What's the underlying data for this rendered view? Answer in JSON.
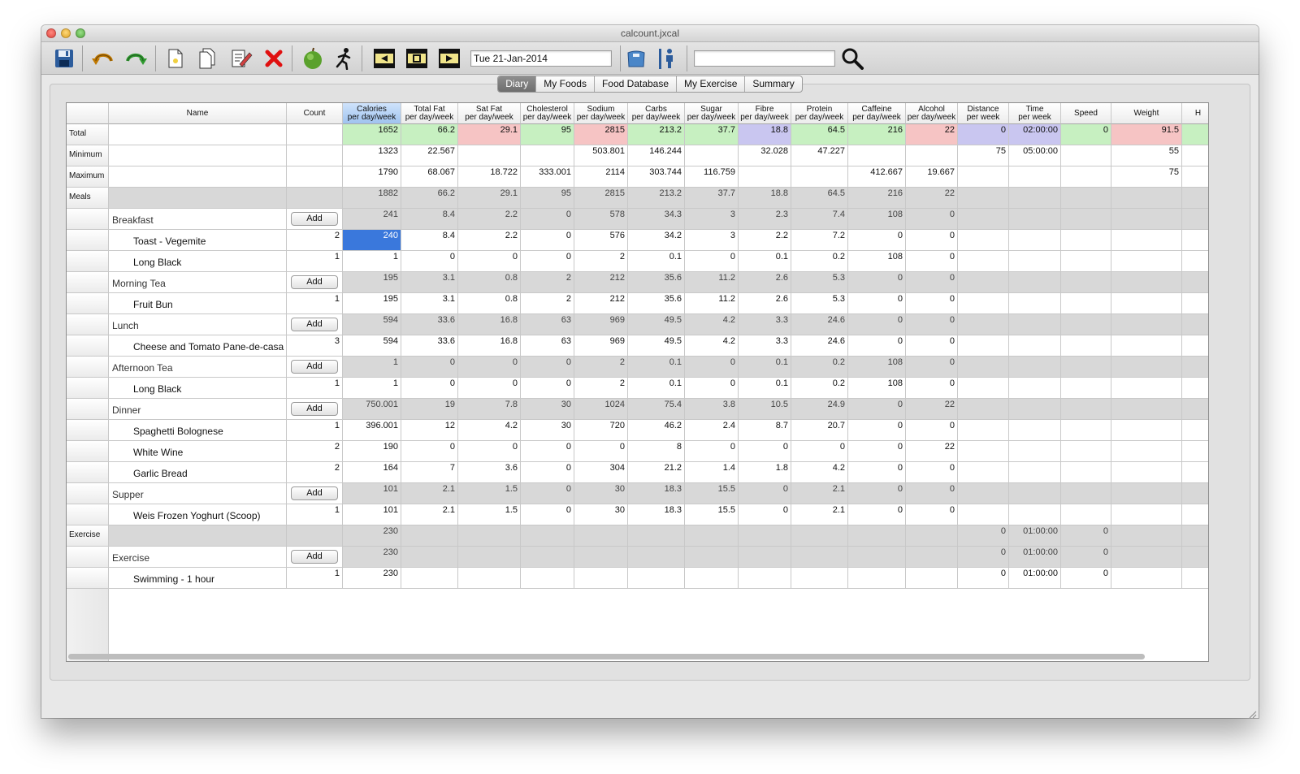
{
  "window": {
    "title": "calcount.jxcal"
  },
  "toolbar": {
    "icons": [
      "save-icon",
      "undo-icon",
      "redo-icon",
      "new-document-icon",
      "copy-document-icon",
      "edit-icon",
      "delete-icon",
      "apple-food-icon",
      "running-exercise-icon",
      "previous-day-icon",
      "today-icon",
      "next-day-icon",
      "scale-icon",
      "body-measure-icon",
      "search-icon"
    ],
    "date": "Tue 21-Jan-2014",
    "search_value": "",
    "colors": {
      "delete": "#e01010",
      "apple": "#5aa12c",
      "undo": "#c07800",
      "redo": "#2f9a2f"
    }
  },
  "tabs": [
    "Diary",
    "My Foods",
    "Food Database",
    "My Exercise",
    "Summary"
  ],
  "active_tab": "Diary",
  "columns": [
    {
      "h1": "Name",
      "h2": ""
    },
    {
      "h1": "Count",
      "h2": ""
    },
    {
      "h1": "Calories",
      "h2": "per day/week"
    },
    {
      "h1": "Total Fat",
      "h2": "per day/week"
    },
    {
      "h1": "Sat Fat",
      "h2": "per day/week"
    },
    {
      "h1": "Cholesterol",
      "h2": "per day/week"
    },
    {
      "h1": "Sodium",
      "h2": "per day/week"
    },
    {
      "h1": "Carbs",
      "h2": "per day/week"
    },
    {
      "h1": "Sugar",
      "h2": "per day/week"
    },
    {
      "h1": "Fibre",
      "h2": "per day/week"
    },
    {
      "h1": "Protein",
      "h2": "per day/week"
    },
    {
      "h1": "Caffeine",
      "h2": "per day/week"
    },
    {
      "h1": "Alcohol",
      "h2": "per day/week"
    },
    {
      "h1": "Distance",
      "h2": "per week"
    },
    {
      "h1": "Time",
      "h2": "per week"
    },
    {
      "h1": "Speed",
      "h2": ""
    },
    {
      "h1": "Weight",
      "h2": ""
    },
    {
      "h1": "H",
      "h2": ""
    }
  ],
  "add_label": "Add",
  "rows": [
    {
      "side": "Total",
      "type": "summary",
      "name": "",
      "count": "",
      "values": [
        "1652",
        "66.2",
        "29.1",
        "95",
        "2815",
        "213.2",
        "37.7",
        "18.8",
        "64.5",
        "216",
        "22",
        "0",
        "02:00:00",
        "0",
        "91.5",
        ""
      ],
      "colors": [
        "green",
        "green",
        "red",
        "green",
        "red",
        "green",
        "green",
        "blue",
        "green",
        "green",
        "red",
        "blue",
        "blue",
        "green",
        "red",
        "green"
      ]
    },
    {
      "side": "Minimum",
      "type": "summary",
      "name": "",
      "count": "",
      "values": [
        "1323",
        "22.567",
        "",
        "",
        "503.801",
        "146.244",
        "",
        "32.028",
        "47.227",
        "",
        "",
        "75",
        "05:00:00",
        "",
        "55",
        ""
      ]
    },
    {
      "side": "Maximum",
      "type": "summary",
      "name": "",
      "count": "",
      "values": [
        "1790",
        "68.067",
        "18.722",
        "333.001",
        "2114",
        "303.744",
        "116.759",
        "",
        "",
        "412.667",
        "19.667",
        "",
        "",
        "",
        "75",
        ""
      ]
    },
    {
      "side": "Meals",
      "type": "section",
      "name": "",
      "count": "",
      "values": [
        "1882",
        "66.2",
        "29.1",
        "95",
        "2815",
        "213.2",
        "37.7",
        "18.8",
        "64.5",
        "216",
        "22",
        "",
        "",
        "",
        "",
        ""
      ]
    },
    {
      "side": "",
      "type": "meal",
      "name": "Breakfast",
      "count": "",
      "values": [
        "241",
        "8.4",
        "2.2",
        "0",
        "578",
        "34.3",
        "3",
        "2.3",
        "7.4",
        "108",
        "0",
        "",
        "",
        "",
        "",
        ""
      ]
    },
    {
      "side": "",
      "type": "item",
      "selected": true,
      "name": "Toast - Vegemite",
      "count": "2",
      "values": [
        "240",
        "8.4",
        "2.2",
        "0",
        "576",
        "34.2",
        "3",
        "2.2",
        "7.2",
        "0",
        "0",
        "",
        "",
        "",
        "",
        ""
      ]
    },
    {
      "side": "",
      "type": "item",
      "name": "Long Black",
      "count": "1",
      "values": [
        "1",
        "0",
        "0",
        "0",
        "2",
        "0.1",
        "0",
        "0.1",
        "0.2",
        "108",
        "0",
        "",
        "",
        "",
        "",
        ""
      ]
    },
    {
      "side": "",
      "type": "meal",
      "name": "Morning Tea",
      "count": "",
      "values": [
        "195",
        "3.1",
        "0.8",
        "2",
        "212",
        "35.6",
        "11.2",
        "2.6",
        "5.3",
        "0",
        "0",
        "",
        "",
        "",
        "",
        ""
      ]
    },
    {
      "side": "",
      "type": "item",
      "name": "Fruit Bun",
      "count": "1",
      "values": [
        "195",
        "3.1",
        "0.8",
        "2",
        "212",
        "35.6",
        "11.2",
        "2.6",
        "5.3",
        "0",
        "0",
        "",
        "",
        "",
        "",
        ""
      ]
    },
    {
      "side": "",
      "type": "meal",
      "name": "Lunch",
      "count": "",
      "values": [
        "594",
        "33.6",
        "16.8",
        "63",
        "969",
        "49.5",
        "4.2",
        "3.3",
        "24.6",
        "0",
        "0",
        "",
        "",
        "",
        "",
        ""
      ]
    },
    {
      "side": "",
      "type": "item",
      "name": "Cheese and Tomato Pane-de-casa",
      "count": "3",
      "values": [
        "594",
        "33.6",
        "16.8",
        "63",
        "969",
        "49.5",
        "4.2",
        "3.3",
        "24.6",
        "0",
        "0",
        "",
        "",
        "",
        "",
        ""
      ]
    },
    {
      "side": "",
      "type": "meal",
      "name": "Afternoon Tea",
      "count": "",
      "values": [
        "1",
        "0",
        "0",
        "0",
        "2",
        "0.1",
        "0",
        "0.1",
        "0.2",
        "108",
        "0",
        "",
        "",
        "",
        "",
        ""
      ]
    },
    {
      "side": "",
      "type": "item",
      "name": "Long Black",
      "count": "1",
      "values": [
        "1",
        "0",
        "0",
        "0",
        "2",
        "0.1",
        "0",
        "0.1",
        "0.2",
        "108",
        "0",
        "",
        "",
        "",
        "",
        ""
      ]
    },
    {
      "side": "",
      "type": "meal",
      "name": "Dinner",
      "count": "",
      "values": [
        "750.001",
        "19",
        "7.8",
        "30",
        "1024",
        "75.4",
        "3.8",
        "10.5",
        "24.9",
        "0",
        "22",
        "",
        "",
        "",
        "",
        ""
      ]
    },
    {
      "side": "",
      "type": "item",
      "name": "Spaghetti Bolognese",
      "count": "1",
      "values": [
        "396.001",
        "12",
        "4.2",
        "30",
        "720",
        "46.2",
        "2.4",
        "8.7",
        "20.7",
        "0",
        "0",
        "",
        "",
        "",
        "",
        ""
      ]
    },
    {
      "side": "",
      "type": "item",
      "name": "White Wine",
      "count": "2",
      "values": [
        "190",
        "0",
        "0",
        "0",
        "0",
        "8",
        "0",
        "0",
        "0",
        "0",
        "22",
        "",
        "",
        "",
        "",
        ""
      ]
    },
    {
      "side": "",
      "type": "item",
      "name": "Garlic Bread",
      "count": "2",
      "values": [
        "164",
        "7",
        "3.6",
        "0",
        "304",
        "21.2",
        "1.4",
        "1.8",
        "4.2",
        "0",
        "0",
        "",
        "",
        "",
        "",
        ""
      ]
    },
    {
      "side": "",
      "type": "meal",
      "name": "Supper",
      "count": "",
      "values": [
        "101",
        "2.1",
        "1.5",
        "0",
        "30",
        "18.3",
        "15.5",
        "0",
        "2.1",
        "0",
        "0",
        "",
        "",
        "",
        "",
        ""
      ]
    },
    {
      "side": "",
      "type": "item",
      "name": "Weis Frozen Yoghurt (Scoop)",
      "count": "1",
      "values": [
        "101",
        "2.1",
        "1.5",
        "0",
        "30",
        "18.3",
        "15.5",
        "0",
        "2.1",
        "0",
        "0",
        "",
        "",
        "",
        "",
        ""
      ]
    },
    {
      "side": "Exercise",
      "type": "section",
      "name": "",
      "count": "",
      "values": [
        "230",
        "",
        "",
        "",
        "",
        "",
        "",
        "",
        "",
        "",
        "",
        "0",
        "01:00:00",
        "0",
        "",
        ""
      ]
    },
    {
      "side": "",
      "type": "meal",
      "name": "Exercise",
      "count": "",
      "values": [
        "230",
        "",
        "",
        "",
        "",
        "",
        "",
        "",
        "",
        "",
        "",
        "0",
        "01:00:00",
        "0",
        "",
        ""
      ]
    },
    {
      "side": "",
      "type": "item",
      "name": "Swimming - 1 hour",
      "count": "1",
      "values": [
        "230",
        "",
        "",
        "",
        "",
        "",
        "",
        "",
        "",
        "",
        "",
        "0",
        "01:00:00",
        "0",
        "",
        ""
      ]
    }
  ]
}
